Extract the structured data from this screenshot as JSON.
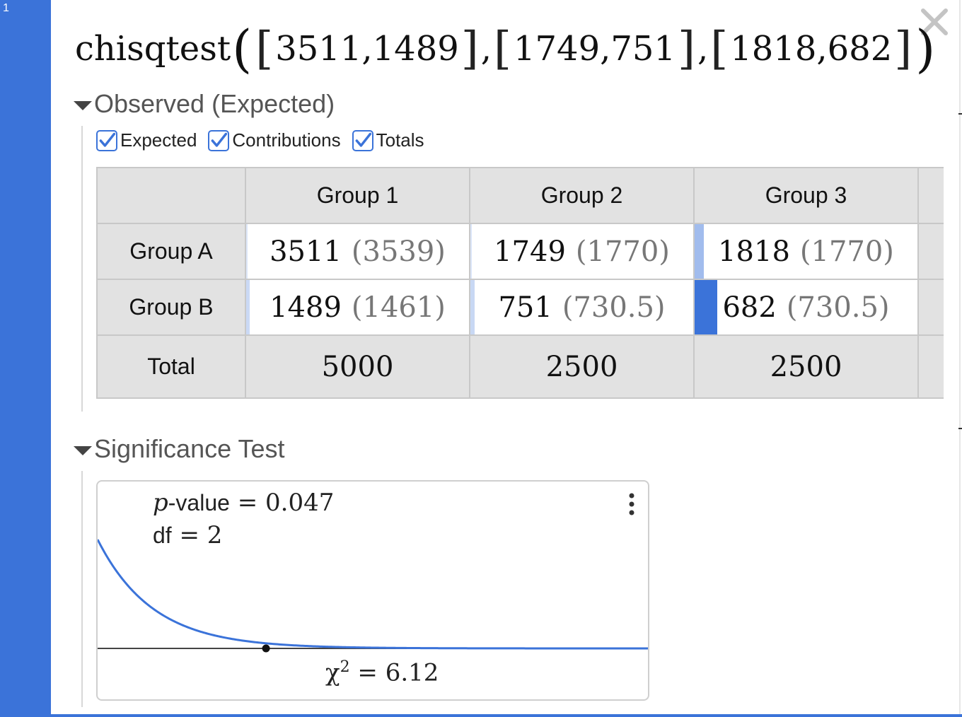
{
  "gutter": {
    "line_number": "1",
    "color": "#3b73d9"
  },
  "expression": {
    "function_name": "chisqtest",
    "lists": [
      {
        "values": [
          "3511",
          "1489"
        ]
      },
      {
        "values": [
          "1749",
          "751"
        ]
      },
      {
        "values": [
          "1818",
          "682"
        ]
      }
    ]
  },
  "observed_section": {
    "header": "Observed (Expected)",
    "checkboxes": [
      {
        "label": "Expected",
        "checked": true
      },
      {
        "label": "Contributions",
        "checked": true
      },
      {
        "label": "Totals",
        "checked": true
      }
    ],
    "table": {
      "columns": [
        "Group 1",
        "Group 2",
        "Group 3"
      ],
      "rows": [
        {
          "label": "Group A",
          "cells": [
            {
              "observed": "3511",
              "expected": "(3539)",
              "contribution": 0.22
            },
            {
              "observed": "1749",
              "expected": "(1770)",
              "contribution": 0.25
            },
            {
              "observed": "1818",
              "expected": "(1770)",
              "contribution": 1.3
            }
          ]
        },
        {
          "label": "Group B",
          "cells": [
            {
              "observed": "1489",
              "expected": "(1461)",
              "contribution": 0.54
            },
            {
              "observed": "751",
              "expected": "(730.5)",
              "contribution": 0.6
            },
            {
              "observed": "682",
              "expected": "(730.5)",
              "contribution": 3.21
            }
          ]
        }
      ],
      "totals_label": "Total",
      "totals": [
        "5000",
        "2500",
        "2500"
      ]
    }
  },
  "significance_section": {
    "header": "Significance Test",
    "p_value_symbol": "p",
    "p_value_word": "-value",
    "p_value": "0.047",
    "df_label": "df",
    "df": "2",
    "chi_symbol": "χ",
    "chi_exponent": "2",
    "chi_value": "6.12",
    "curve_color": "#3b73d9",
    "chart_data": {
      "type": "line",
      "distribution": "chi-square",
      "df": 2,
      "statistic": 6.12,
      "xlim": [
        0,
        20
      ],
      "title": "",
      "xlabel": "",
      "ylabel": ""
    }
  }
}
